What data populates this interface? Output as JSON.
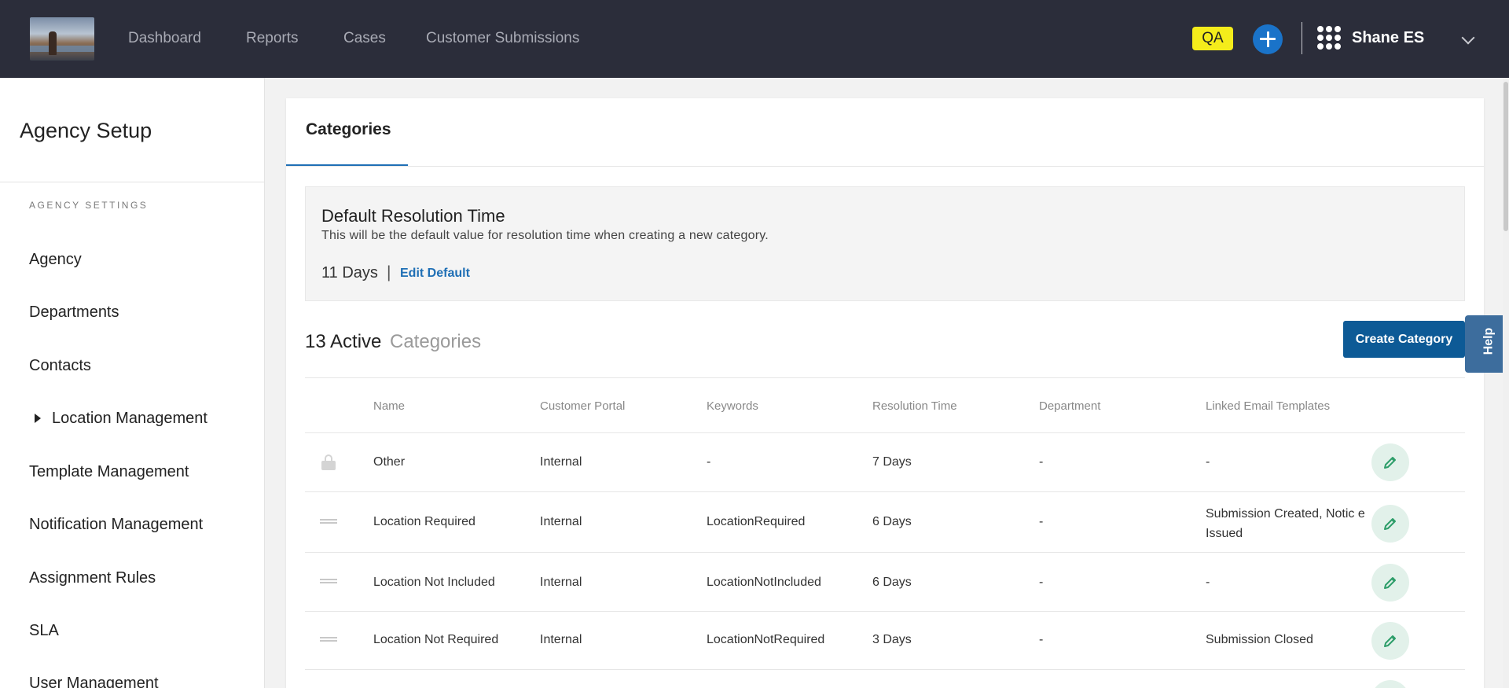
{
  "nav": {
    "links": [
      "Dashboard",
      "Reports",
      "Cases",
      "Customer Submissions"
    ],
    "env_badge": "QA",
    "user_name": "Shane ES"
  },
  "sidebar": {
    "title": "Agency Setup",
    "section": "AGENCY SETTINGS",
    "items": [
      "Agency",
      "Departments",
      "Contacts",
      "Location Management",
      "Template Management",
      "Notification Management",
      "Assignment Rules",
      "SLA",
      "User Management"
    ]
  },
  "main": {
    "tab": "Categories",
    "default_resolution": {
      "title": "Default Resolution Time",
      "description": "This will be the default value for resolution time when creating a new category.",
      "value": "11 Days",
      "separator": "|",
      "edit_label": "Edit Default"
    },
    "count_number": "13 Active",
    "count_label": "Categories",
    "create_button": "Create Category",
    "table": {
      "headers": [
        "Name",
        "Customer Portal",
        "Keywords",
        "Resolution Time",
        "Department",
        "Linked Email Templates"
      ],
      "rows": [
        {
          "name": "Other",
          "portal": "Internal",
          "keywords": "-",
          "resolution": "7 Days",
          "department": "-",
          "templates": "-"
        },
        {
          "name": "Location Required",
          "portal": "Internal",
          "keywords": "LocationRequired",
          "resolution": "6 Days",
          "department": "-",
          "templates": "Submission Created, Notic e Issued"
        },
        {
          "name": "Location Not Included",
          "portal": "Internal",
          "keywords": "LocationNotIncluded",
          "resolution": "6 Days",
          "department": "-",
          "templates": "-"
        },
        {
          "name": "Location Not Required",
          "portal": "Internal",
          "keywords": "LocationNotRequired",
          "resolution": "3 Days",
          "department": "-",
          "templates": "Submission Closed"
        }
      ]
    }
  },
  "help_label": "Help",
  "colors": {
    "topbar": "#2b2d3a",
    "accent": "#1f6fb5",
    "primary_button": "#0d5a96",
    "env_badge": "#f4ec1b",
    "edit_button_bg": "#e2f1ea",
    "edit_icon": "#2e9e6a"
  },
  "icons": [
    "agency-logo",
    "plus-icon",
    "apps-grid-icon",
    "chevron-down-icon",
    "caret-right-icon",
    "lock-icon",
    "drag-handle-icon",
    "pencil-icon"
  ]
}
